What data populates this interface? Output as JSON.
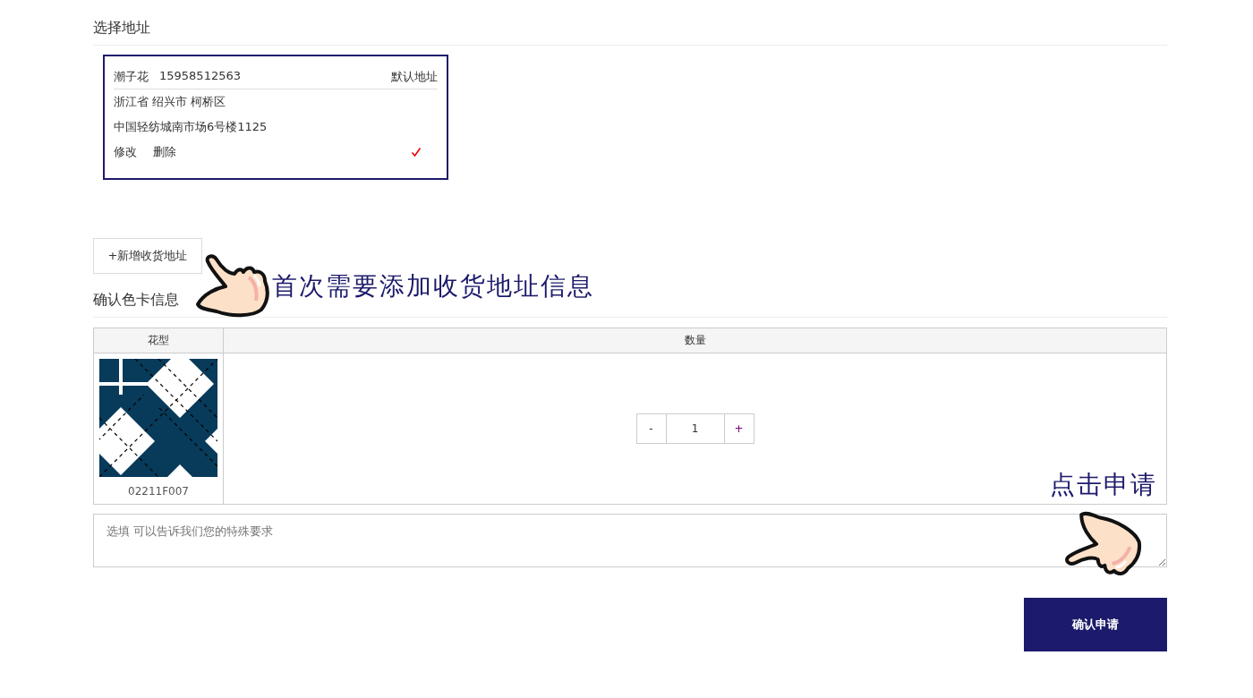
{
  "address_section": {
    "title": "选择地址",
    "addresses": [
      {
        "name": "潮子花",
        "phone": "15958512563",
        "default_label": "默认地址",
        "region": "浙江省 绍兴市 柯桥区",
        "street": "中国轻纺城南市场6号楼1125",
        "actions": [
          "修改",
          "删除"
        ],
        "selected": true
      }
    ],
    "add_button": "+新增收货地址"
  },
  "address_hint": {
    "text": "首次需要添加收货地址信息"
  },
  "color_card_section": {
    "title": "确认色卡信息",
    "table": {
      "columns": [
        "花型",
        "数量"
      ],
      "rows": [
        {
          "pattern_code": "02211F007",
          "quantity": {
            "decrement": "-",
            "value": "1",
            "increment": "+"
          }
        }
      ]
    }
  },
  "submit_hint": {
    "text": "点击申请"
  },
  "note": {
    "placeholder": "选填 可以告诉我们您的特殊要求"
  },
  "submit_button": "确认申请"
}
